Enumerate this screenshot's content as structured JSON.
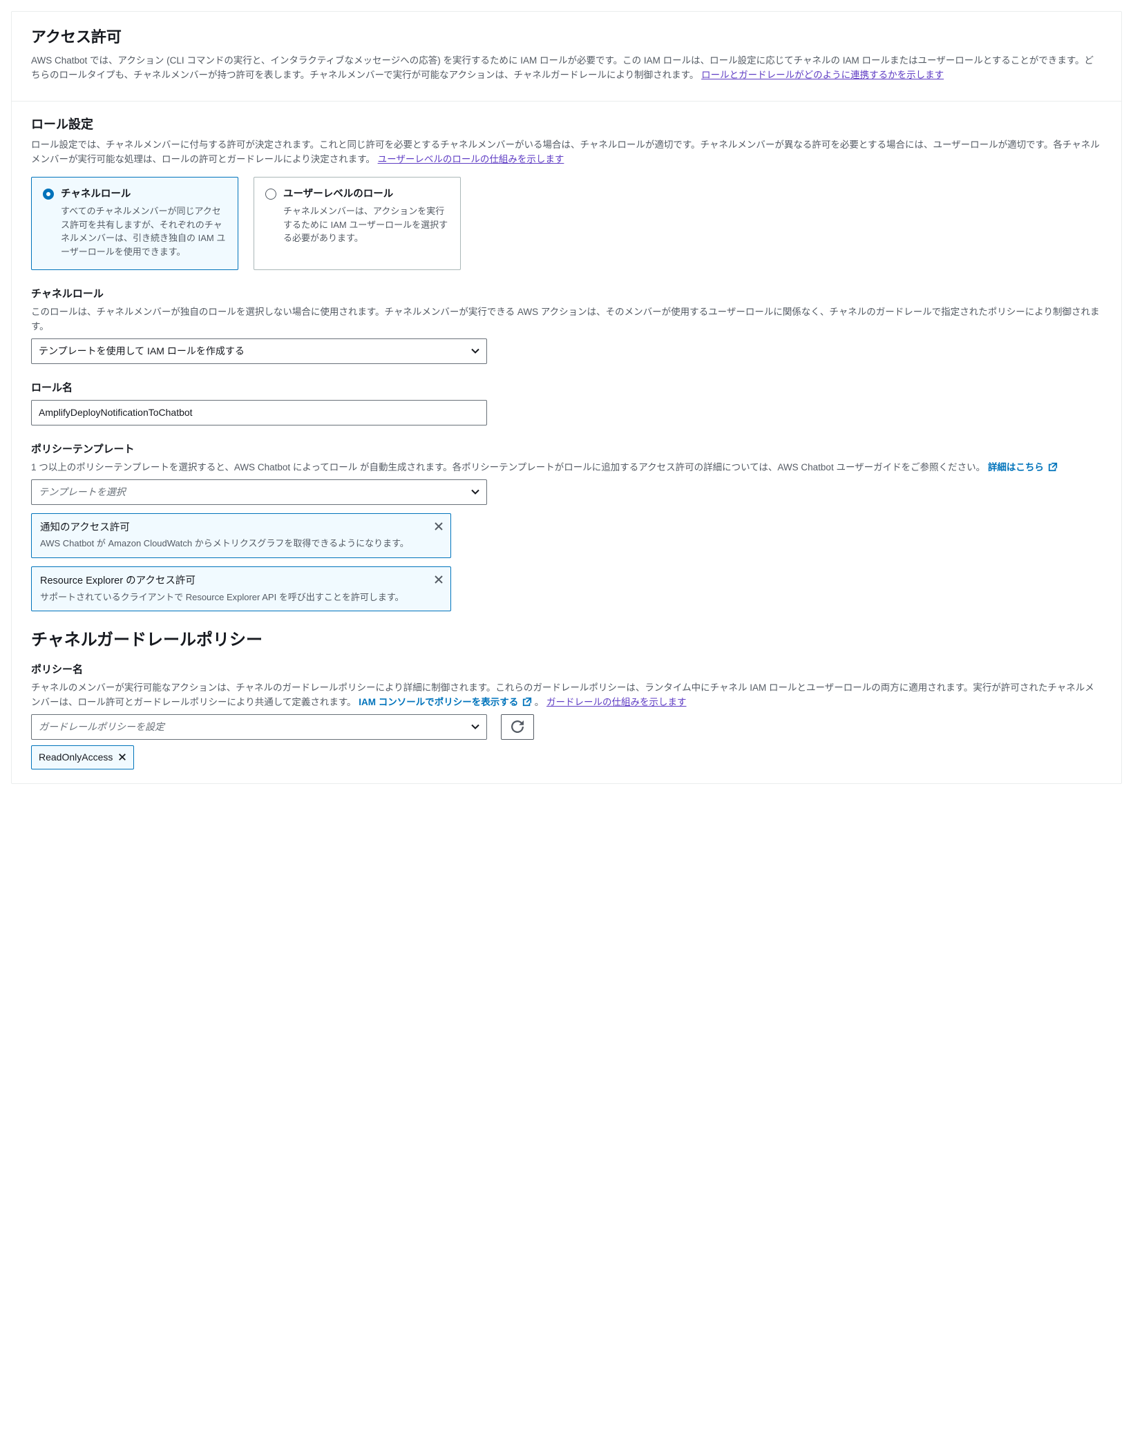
{
  "permissions": {
    "title": "アクセス許可",
    "desc": "AWS Chatbot では、アクション (CLI コマンドの実行と、インタラクティブなメッセージへの応答) を実行するために IAM ロールが必要です。この IAM ロールは、ロール設定に応じてチャネルの IAM ロールまたはユーザーロールとすることができます。どちらのロールタイプも、チャネルメンバーが持つ許可を表します。チャネルメンバーで実行が可能なアクションは、チャネルガードレールにより制御されます。 ",
    "link": "ロールとガードレールがどのように連携するかを示します"
  },
  "roleSettings": {
    "title": "ロール設定",
    "desc": "ロール設定では、チャネルメンバーに付与する許可が決定されます。これと同じ許可を必要とするチャネルメンバーがいる場合は、チャネルロールが適切です。チャネルメンバーが異なる許可を必要とする場合には、ユーザーロールが適切です。各チャネルメンバーが実行可能な処理は、ロールの許可とガードレールにより決定されます。 ",
    "link": "ユーザーレベルのロールの仕組みを示します",
    "options": [
      {
        "label": "チャネルロール",
        "desc": "すべてのチャネルメンバーが同じアクセス許可を共有しますが、それぞれのチャネルメンバーは、引き続き独自の IAM ユーザーロールを使用できます。",
        "selected": true
      },
      {
        "label": "ユーザーレベルのロール",
        "desc": "チャネルメンバーは、アクションを実行するために IAM ユーザーロールを選択する必要があります。",
        "selected": false
      }
    ]
  },
  "channelRole": {
    "title": "チャネルロール",
    "desc": "このロールは、チャネルメンバーが独自のロールを選択しない場合に使用されます。チャネルメンバーが実行できる AWS アクションは、そのメンバーが使用するユーザーロールに関係なく、チャネルのガードレールで指定されたポリシーにより制御されます。",
    "selectValue": "テンプレートを使用して IAM ロールを作成する"
  },
  "roleName": {
    "title": "ロール名",
    "value": "AmplifyDeployNotificationToChatbot"
  },
  "policyTemplates": {
    "title": "ポリシーテンプレート",
    "desc": "1 つ以上のポリシーテンプレートを選択すると、AWS Chatbot によってロール が自動生成されます。各ポリシーテンプレートがロールに追加するアクセス許可の詳細については、AWS Chatbot ユーザーガイドをご参照ください。 ",
    "link": "詳細はこちら ",
    "placeholder": "テンプレートを選択",
    "selected": [
      {
        "title": "通知のアクセス許可",
        "desc": "AWS Chatbot が Amazon CloudWatch からメトリクスグラフを取得できるようになります。"
      },
      {
        "title": "Resource Explorer のアクセス許可",
        "desc": "サポートされているクライアントで Resource Explorer API を呼び出すことを許可します。"
      }
    ]
  },
  "guardrail": {
    "heading": "チャネルガードレールポリシー",
    "title": "ポリシー名",
    "desc": "チャネルのメンバーが実行可能なアクションは、チャネルのガードレールポリシーにより詳細に制御されます。これらのガードレールポリシーは、ランタイム中にチャネル IAM ロールとユーザーロールの両方に適用されます。実行が許可されたチャネルメンバーは、ロール許可とガードレールポリシーにより共通して定義されます。",
    "consoleLink": "IAM コンソールでポリシーを表示する ",
    "mechanismLink": "ガードレールの仕組みを示します",
    "period": "。 ",
    "placeholder": "ガードレールポリシーを設定",
    "chips": [
      "ReadOnlyAccess"
    ]
  }
}
